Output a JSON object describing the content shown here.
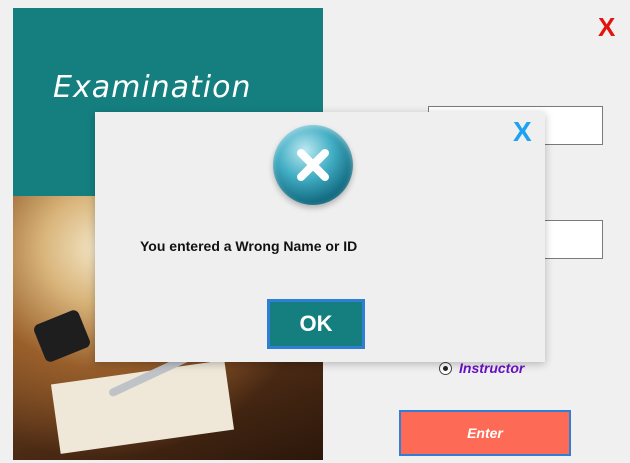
{
  "app": {
    "title": "Examination"
  },
  "window": {
    "close_icon": "X"
  },
  "dialog": {
    "close_icon": "X",
    "icon": "error-x-icon",
    "message": "You entered a Wrong Name or ID",
    "ok_label": "OK"
  },
  "role": {
    "label": "Instructor",
    "selected": true
  },
  "enter_label": "Enter",
  "colors": {
    "brand_teal": "#157f80",
    "close_red": "#e3130f",
    "dialog_close_blue": "#1da1f2",
    "instructor_purple": "#6a10c9",
    "enter_bg": "#fd6a55"
  }
}
